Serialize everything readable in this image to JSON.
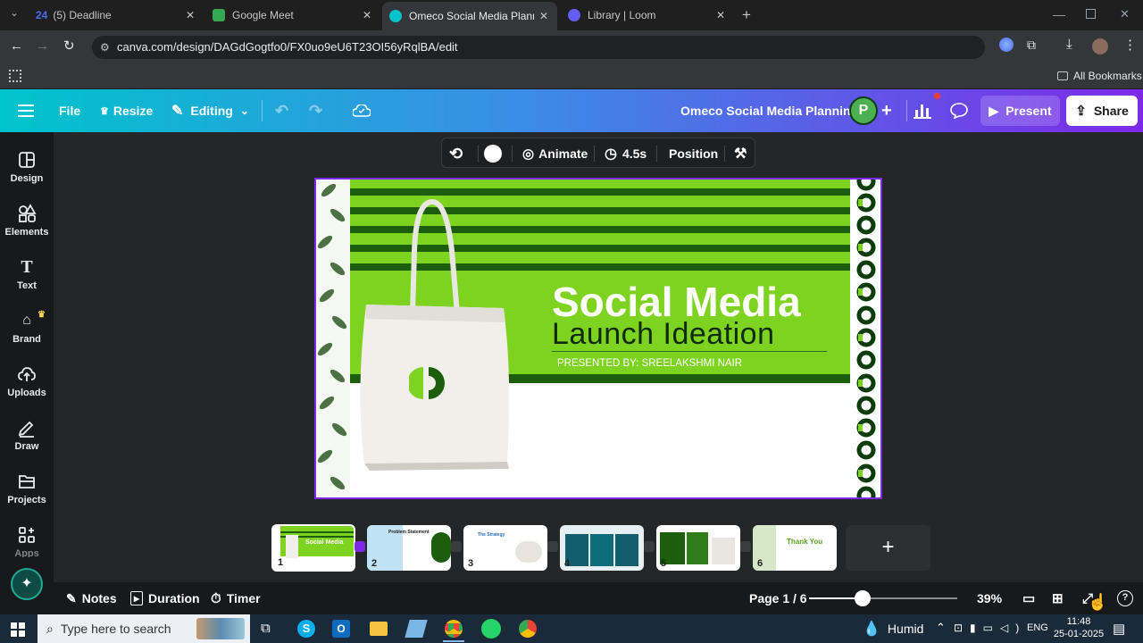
{
  "browser": {
    "tabs": [
      {
        "title": "(5) Deadline",
        "icon": "deadline-icon",
        "color": "#4b6cf5"
      },
      {
        "title": "Google Meet",
        "icon": "google-meet-icon",
        "color": "#34a853"
      },
      {
        "title": "Omeco Social Media Planning",
        "icon": "canva-icon",
        "color": "#7d2ae8",
        "active": true
      },
      {
        "title": "Library | Loom",
        "icon": "loom-icon",
        "color": "#625df5"
      }
    ],
    "url": "canva.com/design/DAGdGogtfo0/FX0uo9eU6T23OI56yRqlBA/edit",
    "bookmarks_label": "All Bookmarks"
  },
  "canva": {
    "header": {
      "file": "File",
      "resize": "Resize",
      "editing": "Editing",
      "doc_title": "Omeco Social Media Planning",
      "avatar": "P",
      "present": "Present",
      "share": "Share"
    },
    "rail": [
      "Design",
      "Elements",
      "Text",
      "Brand",
      "Uploads",
      "Draw",
      "Projects",
      "Apps"
    ],
    "context_bar": {
      "animate": "Animate",
      "duration": "4.5s",
      "position": "Position"
    },
    "slide": {
      "title": "Social Media",
      "subtitle": "Launch Ideation",
      "presented_by": "PRESENTED BY: SREELAKSHMI NAIR"
    },
    "thumbnails": [
      {
        "num": "1",
        "label": "Social Media"
      },
      {
        "num": "2",
        "label": "Problem Statement"
      },
      {
        "num": "3",
        "label": "The Strategy"
      },
      {
        "num": "4",
        "label": ""
      },
      {
        "num": "5",
        "label": ""
      },
      {
        "num": "6",
        "label": "Thank You"
      }
    ],
    "bottom": {
      "notes": "Notes",
      "duration": "Duration",
      "timer": "Timer",
      "page": "Page 1 / 6",
      "zoom": "39%",
      "zoom_fraction": 0.36
    }
  },
  "taskbar": {
    "search_placeholder": "Type here to search",
    "weather": "Humid",
    "lang": "ENG",
    "time": "11:48",
    "date": "25-01-2025"
  },
  "colors": {
    "accent": "#7d2ae8",
    "slide_green": "#7ed321",
    "slide_dark": "#1d5e0c"
  }
}
